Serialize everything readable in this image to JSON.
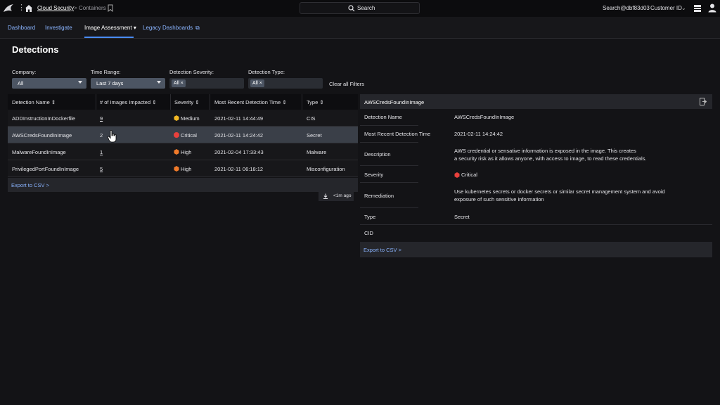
{
  "topbar": {
    "breadcrumb_root": "Cloud Security",
    "breadcrumb_sep": ">",
    "breadcrumb_current": "Containers",
    "search_label": "Search",
    "account": "Search@dbf83d03",
    "customer_id": "Customer ID",
    "icons": [
      "falcon-logo-icon",
      "grid-dots-icon",
      "home-icon",
      "bookmark-icon",
      "search-icon",
      "chevron-down-icon",
      "panels-icon",
      "user-icon"
    ]
  },
  "nav": {
    "tabs": [
      {
        "label": "Dashboard"
      },
      {
        "label": "Investigate"
      },
      {
        "label": "Image Assessment"
      },
      {
        "label": "Legacy Dashboards"
      }
    ],
    "active_tab": "Image Assessment",
    "accent_color": "#4a8cff"
  },
  "page": {
    "title": "Detections"
  },
  "filters": {
    "company_label": "Company:",
    "company_value": "All",
    "time_label": "Time Range:",
    "time_value": "Last 7 days",
    "severity_label": "Detection Severity:",
    "severity_chip": "All",
    "type_label": "Detection Type:",
    "type_chip": "All",
    "clear_all": "Clear all Filters"
  },
  "table": {
    "headers": [
      "Detection Name",
      "# of Images Impacted",
      "Severity",
      "Most Recent Detection Time",
      "Type"
    ],
    "rows": [
      {
        "name": "ADDInstructionInDockerfile",
        "images": "9",
        "severity": "Medium",
        "time": "2021-02-11 14:44:49",
        "type": "CIS"
      },
      {
        "name": "AWSCredsFoundInImage",
        "images": "2",
        "severity": "Critical",
        "time": "2021-02-11 14:24:42",
        "type": "Secret"
      },
      {
        "name": "MalwareFoundInImage",
        "images": "1",
        "severity": "High",
        "time": "2021-02-04 17:33:43",
        "type": "Malware"
      },
      {
        "name": "PrivilegedPortFoundInImage",
        "images": "5",
        "severity": "High",
        "time": "2021-02-11 06:18:12",
        "type": "Misconfiguration"
      }
    ],
    "selected_row": 1,
    "export": "Export to CSV >",
    "refresh": "<1m ago",
    "severity_colors": {
      "Medium": "#f2b824",
      "Critical": "#e8403c",
      "High": "#f07a2a"
    }
  },
  "detail": {
    "title": "AWSCredsFoundInImage",
    "labels": {
      "name": "Detection Name",
      "time": "Most Recent Detection Time",
      "description": "Description",
      "severity": "Severity",
      "remediation": "Remediation",
      "type": "Type",
      "cid": "CID"
    },
    "values": {
      "name": "AWSCredsFoundInImage",
      "time": "2021-02-11 14:24:42",
      "description_1": "AWS credential or sensative information is exposed in the image. This creates",
      "description_2": "a security risk as it allows anyone, with access to image, to read these credentials.",
      "severity": "Critical",
      "remediation_1": "Use kubernetes secrets or docker secrets or similar secret management system and avoid",
      "remediation_2": "exposure of such sensitive information",
      "type": "Secret",
      "cid": ""
    },
    "export": "Export to CSV >"
  }
}
